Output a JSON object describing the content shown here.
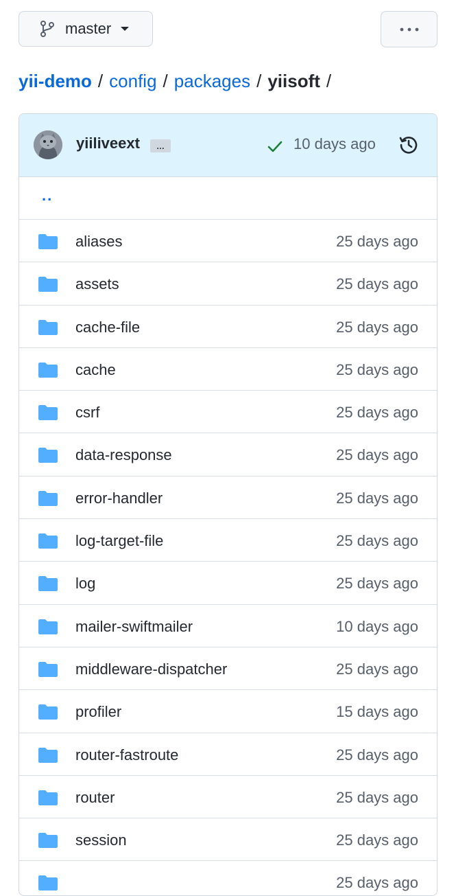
{
  "branch": {
    "name": "master"
  },
  "breadcrumb": {
    "root": "yii-demo",
    "segments": [
      "config",
      "packages"
    ],
    "current": "yiisoft",
    "separator": "/"
  },
  "commit": {
    "author": "yiiliveext",
    "ellipsis": "…",
    "time": "10 days ago",
    "status_color": "#1a7f37"
  },
  "parent_dir": "..",
  "files": [
    {
      "name": "aliases",
      "age": "25 days ago"
    },
    {
      "name": "assets",
      "age": "25 days ago"
    },
    {
      "name": "cache-file",
      "age": "25 days ago"
    },
    {
      "name": "cache",
      "age": "25 days ago"
    },
    {
      "name": "csrf",
      "age": "25 days ago"
    },
    {
      "name": "data-response",
      "age": "25 days ago"
    },
    {
      "name": "error-handler",
      "age": "25 days ago"
    },
    {
      "name": "log-target-file",
      "age": "25 days ago"
    },
    {
      "name": "log",
      "age": "25 days ago"
    },
    {
      "name": "mailer-swiftmailer",
      "age": "10 days ago"
    },
    {
      "name": "middleware-dispatcher",
      "age": "25 days ago"
    },
    {
      "name": "profiler",
      "age": "15 days ago"
    },
    {
      "name": "router-fastroute",
      "age": "25 days ago"
    },
    {
      "name": "router",
      "age": "25 days ago"
    },
    {
      "name": "session",
      "age": "25 days ago"
    },
    {
      "name": "",
      "age": "25 days ago"
    }
  ],
  "colors": {
    "link": "#0969da",
    "folder": "#54aeff",
    "commit_bar": "#ddf4ff"
  }
}
